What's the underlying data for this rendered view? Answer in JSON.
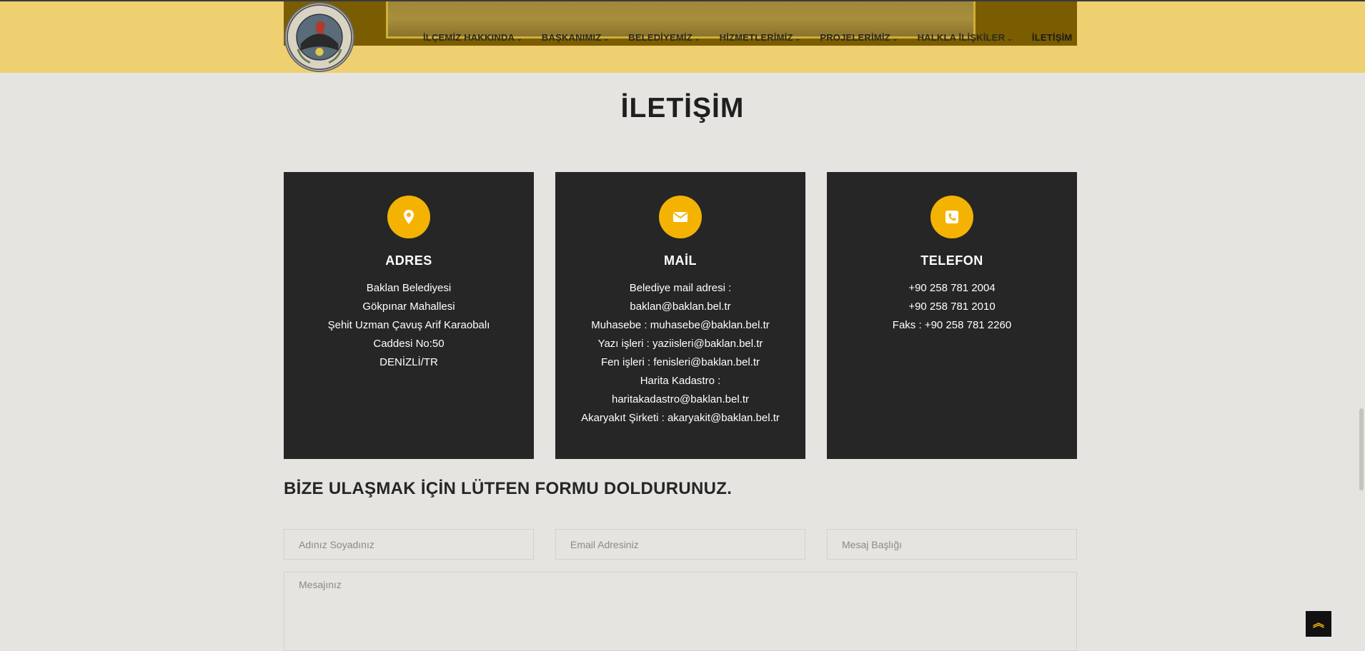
{
  "header": {
    "logo_alt": "T.C. BAKLAN BELEDİYESİ",
    "nav": [
      {
        "label": "İLÇEMİZ HAKKINDA",
        "has_dropdown": true
      },
      {
        "label": "BAŞKANIMIZ",
        "has_dropdown": true
      },
      {
        "label": "BELEDİYEMİZ",
        "has_dropdown": true
      },
      {
        "label": "HİZMETLERİMİZ",
        "has_dropdown": true
      },
      {
        "label": "PROJELERİMİZ",
        "has_dropdown": true
      },
      {
        "label": "HALKLA İLİŞKİLER",
        "has_dropdown": true
      },
      {
        "label": "İLETİŞİM",
        "has_dropdown": false
      }
    ],
    "dropdown_glyph": "⌄"
  },
  "page": {
    "title": "İLETİŞİM"
  },
  "cards": {
    "address": {
      "icon": "map-pin-icon",
      "title": "ADRES",
      "lines": [
        "Baklan Belediyesi",
        "Gökpınar Mahallesi",
        "Şehit Uzman Çavuş Arif Karaobalı",
        "Caddesi No:50",
        "DENİZLİ/TR"
      ]
    },
    "mail": {
      "icon": "envelope-icon",
      "title": "MAİL",
      "lines": [
        "Belediye mail adresi :",
        "baklan@baklan.bel.tr",
        "Muhasebe : muhasebe@baklan.bel.tr",
        "Yazı işleri : yaziisleri@baklan.bel.tr",
        "Fen işleri : fenisleri@baklan.bel.tr",
        "Harita Kadastro :",
        "haritakadastro@baklan.bel.tr",
        "Akaryakıt Şirketi : akaryakit@baklan.bel.tr"
      ]
    },
    "phone": {
      "icon": "phone-icon",
      "title": "TELEFON",
      "lines": [
        "+90 258 781 2004",
        "+90 258 781 2010",
        "Faks : +90 258 781 2260"
      ]
    }
  },
  "form": {
    "title": "BİZE ULAŞMAK İÇİN LÜTFEN FORMU DOLDURUNUZ.",
    "name_placeholder": "Adınız Soyadınız",
    "email_placeholder": "Email Adresiniz",
    "subject_placeholder": "Mesaj Başlığı",
    "message_placeholder": "Mesajınız"
  },
  "scroll_top": {
    "icon": "double-chevron-up-icon",
    "glyph": "︽"
  },
  "colors": {
    "header_bg": "#eed071",
    "accent": "#f4b303",
    "card_bg": "#262626",
    "page_bg": "#e5e4e0"
  }
}
